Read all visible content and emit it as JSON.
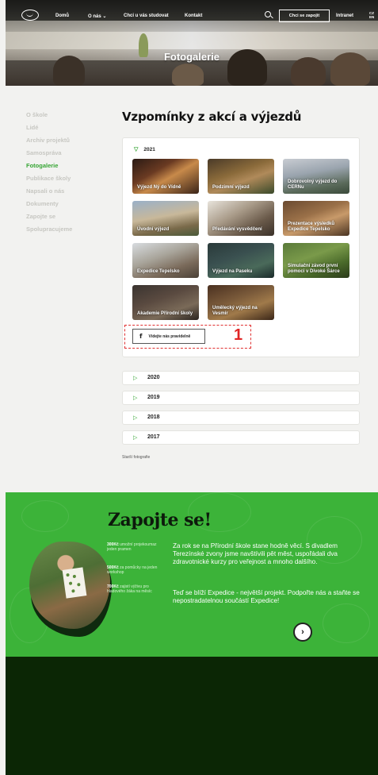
{
  "nav": {
    "items": [
      "Domů",
      "O nás ⌄",
      "Chci u vás studovat",
      "Kontakt"
    ],
    "join_label": "Chci se zapojit",
    "intranet": "Intranet",
    "lang_cz": "CZ",
    "lang_en": "EN"
  },
  "hero": {
    "title": "Fotogalerie"
  },
  "sidebar": {
    "items": [
      "O škole",
      "Lidé",
      "Archiv projektů",
      "Samospráva",
      "Fotogalerie",
      "Publikace školy",
      "Napsali o nás",
      "Dokumenty",
      "Zapojte se",
      "Spolupracujeme"
    ],
    "active_index": 4
  },
  "main": {
    "title": "Vzpomínky z akcí a výjezdů",
    "open_year": "2021",
    "albums": [
      "Výjezd Ný do Vídně",
      "Podzimní výjezd",
      "Dobrovolný výjezd do CERNu",
      "Úvodní výjezd",
      "Předávání vysvědčení",
      "Prezentace výsledků Expedice Tepelsko",
      "Expedice Tepelsko",
      "Výjezd na Paseku",
      "Simulační závod první pomoci v Divoké Šárce",
      "Akademie Přírodní školy",
      "Umělecký výjezd na Vesmír"
    ],
    "fb_button": "Vídejte nás pravidelně",
    "fb_icon": "f",
    "annotation_mark": "1",
    "closed_years": [
      "2020",
      "2019",
      "2018",
      "2017"
    ],
    "old_photos_link": "Starší fotografie"
  },
  "join": {
    "title": "Zapojte se!",
    "stats": [
      {
        "amount": "300Kč",
        "text": "umožní projekoumaz jeden pramen"
      },
      {
        "amount": "500Kč",
        "text": "za pomůcky na jeden workshop"
      },
      {
        "amount": "700Kč",
        "text": "zajistí výživu pro hladového žáka na měsíc"
      }
    ],
    "paragraph1": "Za rok se na Přírodní škole stane hodně věcí. S divadlem Terezínské zvony jsme navštívili pět měst, uspořádali dva zdravotnické kurzy pro veřejnost a mnoho dalšího.",
    "paragraph2": "Teď se blíží Expedice - největší projekt. Podpořte nás a staňte se nepostradatelnou součástí Expedice!",
    "next_icon": "›"
  },
  "colors": {
    "accent_green": "#36a534",
    "join_bg": "#3cb339",
    "footer_bg": "#0b2605",
    "annotation_red": "#e03030"
  }
}
